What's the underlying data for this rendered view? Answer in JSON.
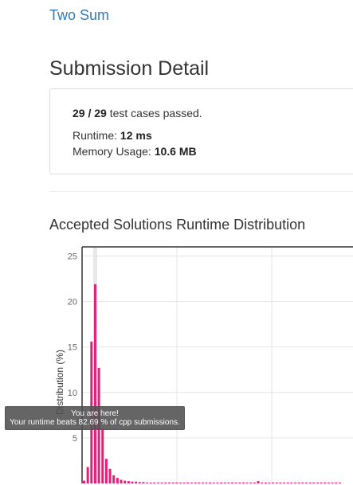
{
  "problem": {
    "title": "Two Sum"
  },
  "page_title": "Submission Detail",
  "result": {
    "passed": "29",
    "separator": " / ",
    "total": "29",
    "passed_suffix": "test cases passed.",
    "runtime_label": "Runtime:",
    "runtime_value": "12 ms",
    "memory_label": "Memory Usage:",
    "memory_value": "10.6 MB"
  },
  "distribution_title": "Accepted Solutions Runtime Distribution",
  "tooltip": {
    "line1": "You are here!",
    "line2": "Your runtime beats 82.69 % of cpp submissions."
  },
  "colors": {
    "link": "#337ab7",
    "bar": "#e91e78",
    "highlight": "#e8e8e8"
  },
  "chart_data": {
    "type": "bar",
    "ylabel": "Distribution (%)",
    "ylim": [
      0,
      26
    ],
    "yticks": [
      "25",
      "20",
      "15",
      "10",
      "5"
    ],
    "ytick_values": [
      25,
      20,
      15,
      10,
      5
    ],
    "grid": true,
    "highlighted_index": 3,
    "values": [
      0.3,
      1.8,
      15.6,
      21.9,
      12.7,
      6.0,
      2.7,
      1.6,
      0.9,
      0.6,
      0.4,
      0.3,
      0.25,
      0.2,
      0.2,
      0.15,
      0.15,
      0.1,
      0.1,
      0.1,
      0.1,
      0.1,
      0.1,
      0.1,
      0.1,
      0.1,
      0.1,
      0.1,
      0.1,
      0.1,
      0.1,
      0.1,
      0.1,
      0.1,
      0.1,
      0.1,
      0.1,
      0.1,
      0.1,
      0.1,
      0.1,
      0.1,
      0.1,
      0.1,
      0.1,
      0.1,
      0.1,
      0.25,
      0.1,
      0.1,
      0.1,
      0.1,
      0.1,
      0.1,
      0.1,
      0.1,
      0.1,
      0.1,
      0.1,
      0.1,
      0.1,
      0.1,
      0.1,
      0.1,
      0.1,
      0.1,
      0.1,
      0.1,
      0.1,
      0.1
    ]
  }
}
